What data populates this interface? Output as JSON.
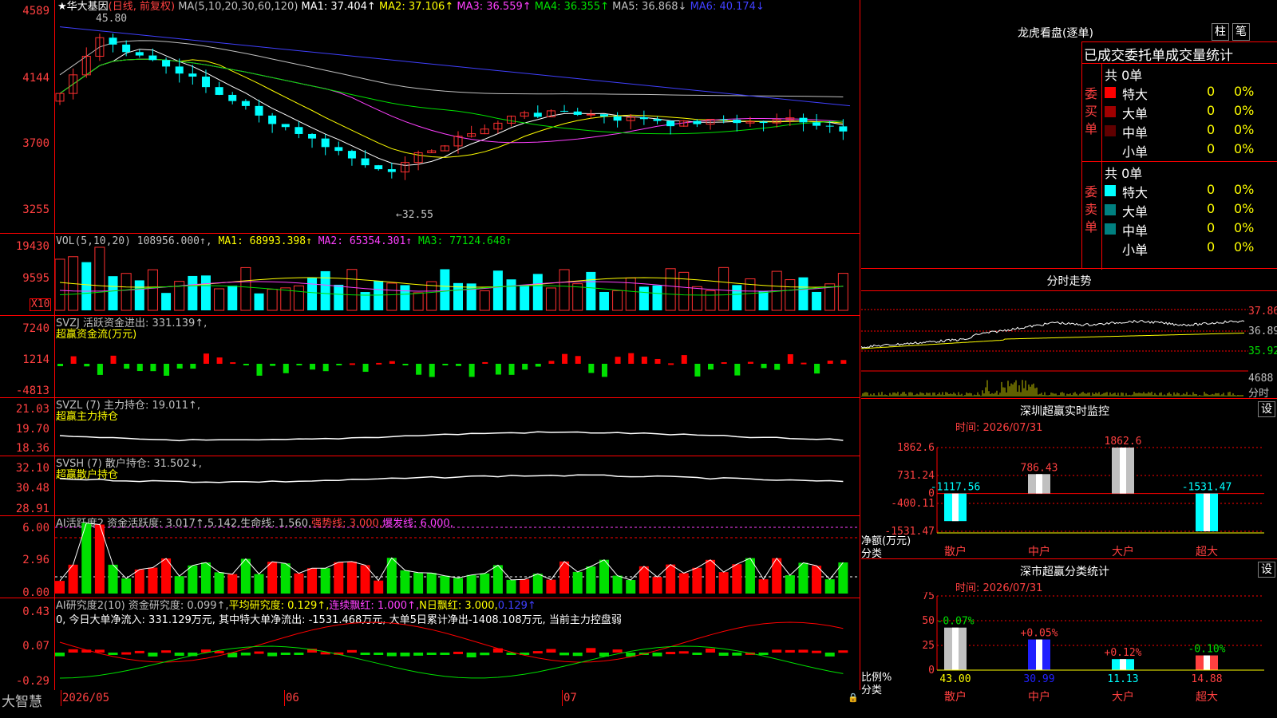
{
  "main_chart": {
    "title": "★华大基因",
    "mode": "(日线, 前复权)",
    "ma_label": "MA(5,10,20,30,60,120)",
    "ma": [
      {
        "name": "MA1:",
        "value": "37.404↑",
        "color": "#ffffff"
      },
      {
        "name": "MA2:",
        "value": "37.106↑",
        "color": "#ffff00"
      },
      {
        "name": "MA3:",
        "value": "36.559↑",
        "color": "#ff40ff"
      },
      {
        "name": "MA4:",
        "value": "36.355↑",
        "color": "#00e000"
      },
      {
        "name": "MA5:",
        "value": "36.868↓",
        "color": "#c0c0c0"
      },
      {
        "name": "MA6:",
        "value": "40.174↓",
        "color": "#4040ff"
      }
    ],
    "y_ticks": [
      "4589",
      "4144",
      "3700",
      "3255"
    ],
    "high_label": "45.80",
    "low_label": "←32.55"
  },
  "volume_panel": {
    "header": "VOL(5,10,20) 108956.000↑,",
    "ma": [
      {
        "name": "MA1:",
        "value": "68993.398↑",
        "color": "#ffff00"
      },
      {
        "name": "MA2:",
        "value": "65354.301↑",
        "color": "#ff40ff"
      },
      {
        "name": "MA3:",
        "value": "77124.648↑",
        "color": "#00e000"
      }
    ],
    "y_ticks": [
      "19430",
      "9595"
    ],
    "unit": "X10"
  },
  "svzj_panel": {
    "header": "SVZJ  活跃资金进出: 331.139↑,",
    "sub": "超赢资金流(万元)",
    "y_ticks": [
      "7240",
      "1214",
      "-4813"
    ]
  },
  "svzl_panel": {
    "header": "SVZL (7) 主力持仓: 19.011↑,",
    "sub": "超赢主力持仓",
    "y_ticks": [
      "21.03",
      "19.70",
      "18.36"
    ]
  },
  "svsh_panel": {
    "header": "SVSH (7) 散户持仓: 31.502↓,",
    "sub": "超赢散户持仓",
    "y_ticks": [
      "32.10",
      "30.48",
      "28.91"
    ]
  },
  "ai_active_panel": {
    "header_main": "AI活跃度2 资金活跃度: 3.017↑,5.142,生命线: 1.560,",
    "header_strong": "强势线: 3.000,",
    "header_burst": "爆发线: 6.000,",
    "y_ticks": [
      "6.00",
      "2.96",
      "0.00"
    ]
  },
  "ai_research_panel": {
    "header_main": "AI研究度2(10) 资金研究度: 0.099↑,",
    "header_avg": "平均研究度: 0.129↑,",
    "header_cont": "连续飘红: 1.000↑,",
    "header_nday": "N日飘红: 3.000,",
    "header_last": "0.129↑",
    "desc": "0, 今日大单净流入: 331.129万元, 其中特大单净流出: -1531.468万元, 大单5日累计净出-1408.108万元, 当前主力控盘弱",
    "y_ticks": [
      "0.43",
      "0.07",
      "-0.29"
    ]
  },
  "x_axis": {
    "brand": "大智慧",
    "labels": [
      "2026/05",
      "06",
      "07"
    ]
  },
  "dragon_tiger": {
    "title": "龙虎看盘(逐单)",
    "btn1": "柱",
    "btn2": "笔",
    "header": "已成交委托单成交量统计",
    "buy_label": "委买单",
    "sell_label": "委卖单",
    "buy_total": "共 0单",
    "sell_total": "共 0单",
    "buy_rows": [
      {
        "label": "特大",
        "count": "0",
        "pct": "0%",
        "color": "#ff0000"
      },
      {
        "label": "大单",
        "count": "0",
        "pct": "0%",
        "color": "#a00000"
      },
      {
        "label": "中单",
        "count": "0",
        "pct": "0%",
        "color": "#600000"
      },
      {
        "label": "小单",
        "count": "0",
        "pct": "0%",
        "color": ""
      }
    ],
    "sell_rows": [
      {
        "label": "特大",
        "count": "0",
        "pct": "0%",
        "color": "#00ffff"
      },
      {
        "label": "大单",
        "count": "0",
        "pct": "0%",
        "color": "#008080"
      },
      {
        "label": "中单",
        "count": "0",
        "pct": "0%",
        "color": "#008080"
      },
      {
        "label": "小单",
        "count": "0",
        "pct": "0%",
        "color": ""
      }
    ]
  },
  "intraday": {
    "title": "分时走势",
    "y_labels": [
      "37.86",
      "36.89",
      "35.92"
    ],
    "vol_label": "4688",
    "vol_unit": "分时"
  },
  "sz_monitor": {
    "title": "深圳超赢实时监控",
    "set_btn": "设",
    "time": "时间: 2026/07/31",
    "y_ticks": [
      "1862.6",
      "731.24",
      "0",
      "-400.11",
      "-1531.47"
    ],
    "bars": [
      {
        "category": "散户",
        "value": -1117.56,
        "label": "-1117.56"
      },
      {
        "category": "中户",
        "value": 786.43,
        "label": "786.43"
      },
      {
        "category": "大户",
        "value": 1862.6,
        "label": "1862.6"
      },
      {
        "category": "超大",
        "value": -1531.47,
        "label": "-1531.47"
      }
    ],
    "ylabel": "净额(万元)",
    "xlabel": "分类"
  },
  "sz_stats": {
    "title": "深市超赢分类统计",
    "set_btn": "设",
    "time": "时间: 2026/07/31",
    "y_ticks": [
      "75",
      "50",
      "25",
      "0"
    ],
    "bars": [
      {
        "category": "散户",
        "value": 43.0,
        "label": "43.00",
        "change": "-0.07%"
      },
      {
        "category": "中户",
        "value": 30.99,
        "label": "30.99",
        "change": "+0.05%"
      },
      {
        "category": "大户",
        "value": 11.13,
        "label": "11.13",
        "change": "+0.12%"
      },
      {
        "category": "超大",
        "value": 14.88,
        "label": "14.88",
        "change": "-0.10%"
      }
    ],
    "ylabel": "比例%",
    "xlabel": "分类"
  },
  "chart_data": [
    {
      "type": "bar",
      "title": "深圳超赢实时监控",
      "categories": [
        "散户",
        "中户",
        "大户",
        "超大"
      ],
      "values": [
        -1117.56,
        786.43,
        1862.6,
        -1531.47
      ],
      "ylabel": "净额(万元)",
      "xlabel": "分类",
      "ylim": [
        -1531.47,
        1862.6
      ]
    },
    {
      "type": "bar",
      "title": "深市超赢分类统计",
      "categories": [
        "散户",
        "中户",
        "大户",
        "超大"
      ],
      "values": [
        43.0,
        30.99,
        11.13,
        14.88
      ],
      "ylabel": "比例%",
      "xlabel": "分类",
      "ylim": [
        0,
        75
      ]
    }
  ]
}
